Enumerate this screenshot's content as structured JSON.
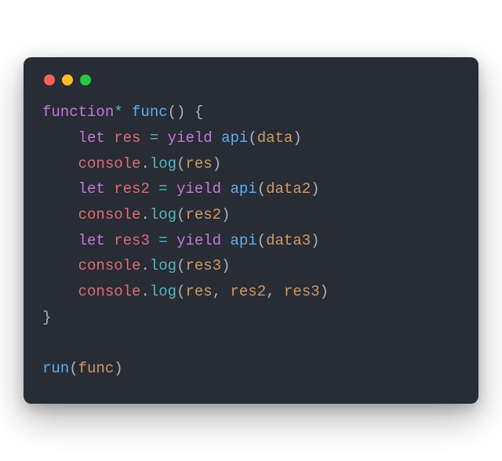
{
  "window": {
    "dots": [
      "#ff5f56",
      "#ffbd2e",
      "#27c93f"
    ]
  },
  "code": {
    "lines": [
      {
        "indent": 0,
        "tokens": [
          {
            "cls": "tok-kw",
            "t": "function"
          },
          {
            "cls": "tok-op",
            "t": "*"
          },
          {
            "cls": "tok-plain",
            "t": " "
          },
          {
            "cls": "tok-fn",
            "t": "func"
          },
          {
            "cls": "tok-punc",
            "t": "()"
          },
          {
            "cls": "tok-plain",
            "t": " "
          },
          {
            "cls": "tok-punc",
            "t": "{"
          }
        ]
      },
      {
        "indent": 1,
        "tokens": [
          {
            "cls": "tok-kw",
            "t": "let"
          },
          {
            "cls": "tok-plain",
            "t": " "
          },
          {
            "cls": "tok-var",
            "t": "res"
          },
          {
            "cls": "tok-plain",
            "t": " "
          },
          {
            "cls": "tok-op",
            "t": "="
          },
          {
            "cls": "tok-plain",
            "t": " "
          },
          {
            "cls": "tok-kw",
            "t": "yield"
          },
          {
            "cls": "tok-plain",
            "t": " "
          },
          {
            "cls": "tok-fn",
            "t": "api"
          },
          {
            "cls": "tok-punc",
            "t": "("
          },
          {
            "cls": "tok-param",
            "t": "data"
          },
          {
            "cls": "tok-punc",
            "t": ")"
          }
        ]
      },
      {
        "indent": 1,
        "tokens": [
          {
            "cls": "tok-var",
            "t": "console"
          },
          {
            "cls": "tok-punc",
            "t": "."
          },
          {
            "cls": "tok-prop",
            "t": "log"
          },
          {
            "cls": "tok-punc",
            "t": "("
          },
          {
            "cls": "tok-param",
            "t": "res"
          },
          {
            "cls": "tok-punc",
            "t": ")"
          }
        ]
      },
      {
        "indent": 1,
        "tokens": [
          {
            "cls": "tok-kw",
            "t": "let"
          },
          {
            "cls": "tok-plain",
            "t": " "
          },
          {
            "cls": "tok-var",
            "t": "res2"
          },
          {
            "cls": "tok-plain",
            "t": " "
          },
          {
            "cls": "tok-op",
            "t": "="
          },
          {
            "cls": "tok-plain",
            "t": " "
          },
          {
            "cls": "tok-kw",
            "t": "yield"
          },
          {
            "cls": "tok-plain",
            "t": " "
          },
          {
            "cls": "tok-fn",
            "t": "api"
          },
          {
            "cls": "tok-punc",
            "t": "("
          },
          {
            "cls": "tok-param",
            "t": "data2"
          },
          {
            "cls": "tok-punc",
            "t": ")"
          }
        ]
      },
      {
        "indent": 1,
        "tokens": [
          {
            "cls": "tok-var",
            "t": "console"
          },
          {
            "cls": "tok-punc",
            "t": "."
          },
          {
            "cls": "tok-prop",
            "t": "log"
          },
          {
            "cls": "tok-punc",
            "t": "("
          },
          {
            "cls": "tok-param",
            "t": "res2"
          },
          {
            "cls": "tok-punc",
            "t": ")"
          }
        ]
      },
      {
        "indent": 1,
        "tokens": [
          {
            "cls": "tok-kw",
            "t": "let"
          },
          {
            "cls": "tok-plain",
            "t": " "
          },
          {
            "cls": "tok-var",
            "t": "res3"
          },
          {
            "cls": "tok-plain",
            "t": " "
          },
          {
            "cls": "tok-op",
            "t": "="
          },
          {
            "cls": "tok-plain",
            "t": " "
          },
          {
            "cls": "tok-kw",
            "t": "yield"
          },
          {
            "cls": "tok-plain",
            "t": " "
          },
          {
            "cls": "tok-fn",
            "t": "api"
          },
          {
            "cls": "tok-punc",
            "t": "("
          },
          {
            "cls": "tok-param",
            "t": "data3"
          },
          {
            "cls": "tok-punc",
            "t": ")"
          }
        ]
      },
      {
        "indent": 1,
        "tokens": [
          {
            "cls": "tok-var",
            "t": "console"
          },
          {
            "cls": "tok-punc",
            "t": "."
          },
          {
            "cls": "tok-prop",
            "t": "log"
          },
          {
            "cls": "tok-punc",
            "t": "("
          },
          {
            "cls": "tok-param",
            "t": "res3"
          },
          {
            "cls": "tok-punc",
            "t": ")"
          }
        ]
      },
      {
        "indent": 1,
        "tokens": [
          {
            "cls": "tok-var",
            "t": "console"
          },
          {
            "cls": "tok-punc",
            "t": "."
          },
          {
            "cls": "tok-prop",
            "t": "log"
          },
          {
            "cls": "tok-punc",
            "t": "("
          },
          {
            "cls": "tok-param",
            "t": "res"
          },
          {
            "cls": "tok-punc",
            "t": ", "
          },
          {
            "cls": "tok-param",
            "t": "res2"
          },
          {
            "cls": "tok-punc",
            "t": ", "
          },
          {
            "cls": "tok-param",
            "t": "res3"
          },
          {
            "cls": "tok-punc",
            "t": ")"
          }
        ]
      },
      {
        "indent": 0,
        "tokens": [
          {
            "cls": "tok-punc",
            "t": "}"
          }
        ]
      },
      {
        "indent": 0,
        "tokens": []
      },
      {
        "indent": 0,
        "tokens": [
          {
            "cls": "tok-fn",
            "t": "run"
          },
          {
            "cls": "tok-punc",
            "t": "("
          },
          {
            "cls": "tok-param",
            "t": "func"
          },
          {
            "cls": "tok-punc",
            "t": ")"
          }
        ]
      }
    ]
  }
}
